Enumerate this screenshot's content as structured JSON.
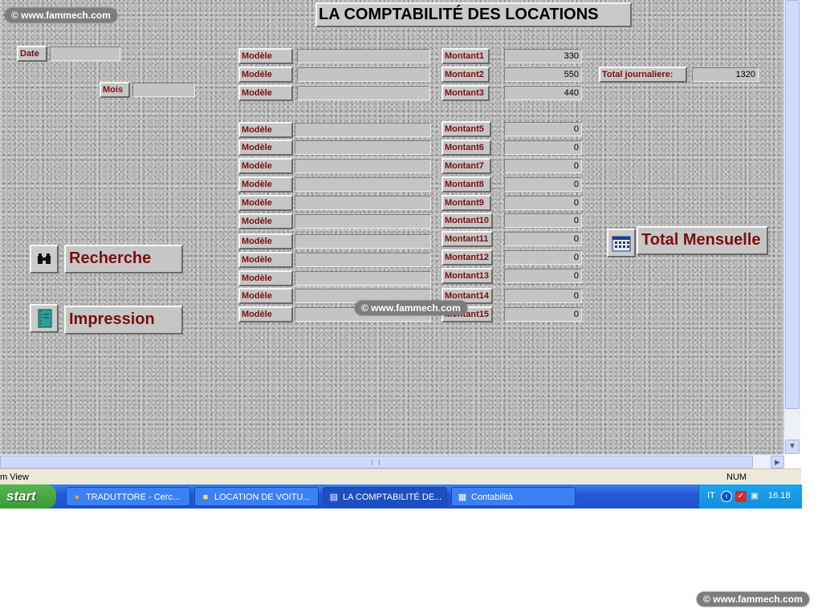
{
  "form": {
    "title": "LA COMPTABILITÉ DES LOCATIONS",
    "date_label": "Date",
    "date_value": "",
    "mois_label": "Mois",
    "mois_value": "",
    "modele_label": "Modèle",
    "rows": [
      {
        "montant_label": "Montant1",
        "value": "330"
      },
      {
        "montant_label": "Montant2",
        "value": "550"
      },
      {
        "montant_label": "Montant3",
        "value": "440"
      },
      {
        "montant_label": "Montant5",
        "value": "0"
      },
      {
        "montant_label": "Montant6",
        "value": "0"
      },
      {
        "montant_label": "Montant7",
        "value": "0"
      },
      {
        "montant_label": "Montant8",
        "value": "0"
      },
      {
        "montant_label": "Montant9",
        "value": "0"
      },
      {
        "montant_label": "Montant10",
        "value": "0"
      },
      {
        "montant_label": "Montant11",
        "value": "0"
      },
      {
        "montant_label": "Montant12",
        "value": "0"
      },
      {
        "montant_label": "Montant13",
        "value": "0"
      },
      {
        "montant_label": "Montant14",
        "value": "0"
      },
      {
        "montant_label": "Montant15",
        "value": "0"
      }
    ],
    "total_journaliere_label": "Total journaliere:",
    "total_journaliere_value": "1320",
    "buttons": {
      "recherche": "Recherche",
      "impression": "Impression",
      "total_mensuelle": "Total Mensuelle"
    }
  },
  "watermark": "© www.fammech.com",
  "statusbar": {
    "left": "m View",
    "right": "NUM"
  },
  "taskbar": {
    "start": "start",
    "tasks": [
      {
        "label": "TRADUTTORE - Cerc...",
        "icon": "firefox-icon"
      },
      {
        "label": "LOCATION DE VOITU...",
        "icon": "folder-icon"
      },
      {
        "label": "LA COMPTABILITÉ DE...",
        "icon": "form-icon"
      },
      {
        "label": "Contabilità",
        "icon": "database-icon"
      }
    ],
    "tray": {
      "language": "IT",
      "clock": "16.18"
    }
  },
  "colors": {
    "label_text": "#7a0f0f",
    "taskbar": "#2459d6",
    "start": "#3a9a35"
  }
}
